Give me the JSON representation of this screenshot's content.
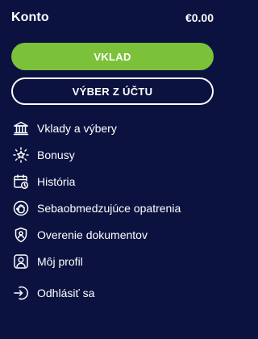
{
  "header": {
    "title": "Konto",
    "balance": "€0.00"
  },
  "buttons": {
    "deposit_label": "VKLAD",
    "withdraw_label": "VÝBER Z ÚČTU"
  },
  "menu": {
    "items": [
      {
        "label": "Vklady a výbery",
        "icon": "bank-icon"
      },
      {
        "label": "Bonusy",
        "icon": "bonus-star-icon"
      },
      {
        "label": "História",
        "icon": "calendar-history-icon"
      },
      {
        "label": "Sebaobmedzujúce opatrenia",
        "icon": "hand-stop-icon"
      },
      {
        "label": "Overenie dokumentov",
        "icon": "shield-user-icon"
      },
      {
        "label": "Môj profil",
        "icon": "profile-icon"
      }
    ],
    "logout_label": "Odhlásiť sa",
    "logout_icon": "logout-icon"
  },
  "colors": {
    "background": "#0b1240",
    "accent_green": "#7cc13a",
    "text": "#ffffff"
  }
}
